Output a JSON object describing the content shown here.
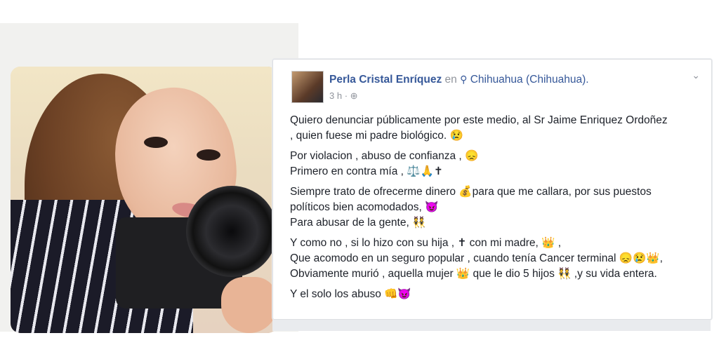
{
  "post": {
    "author": "Perla Cristal Enríquez",
    "en": "en",
    "location_icon": "location-pin-icon",
    "location": "Chihuahua (Chihuahua).",
    "time": "3 h",
    "privacy_icon": "globe-icon",
    "menu_icon": "chevron-down-icon",
    "lines": [
      "Quiero denunciar públicamente por este medio, al Sr Jaime Enriquez Ordoñez",
      ", quien fuese mi padre biológico. 😢",
      "Por violacion , abuso de confianza , 😞",
      "Primero en contra mía , ⚖️🙏✝",
      "Siempre trato de ofrecerme dinero 💰para que me callara, por sus puestos",
      "políticos bien acomodados, 😈",
      "Para abusar de la gente, 👯",
      "Y como no , si lo hizo con su hija , ✝ con mi madre, 👑 ,",
      "Que acomodo en un seguro popular , cuando tenía Cancer terminal 😞😢👑,",
      "Obviamente murió , aquella mujer 👑 que le dio 5 hijos 👯 ,y su vida entera.",
      "Y el solo los abuso 👊😈"
    ]
  }
}
